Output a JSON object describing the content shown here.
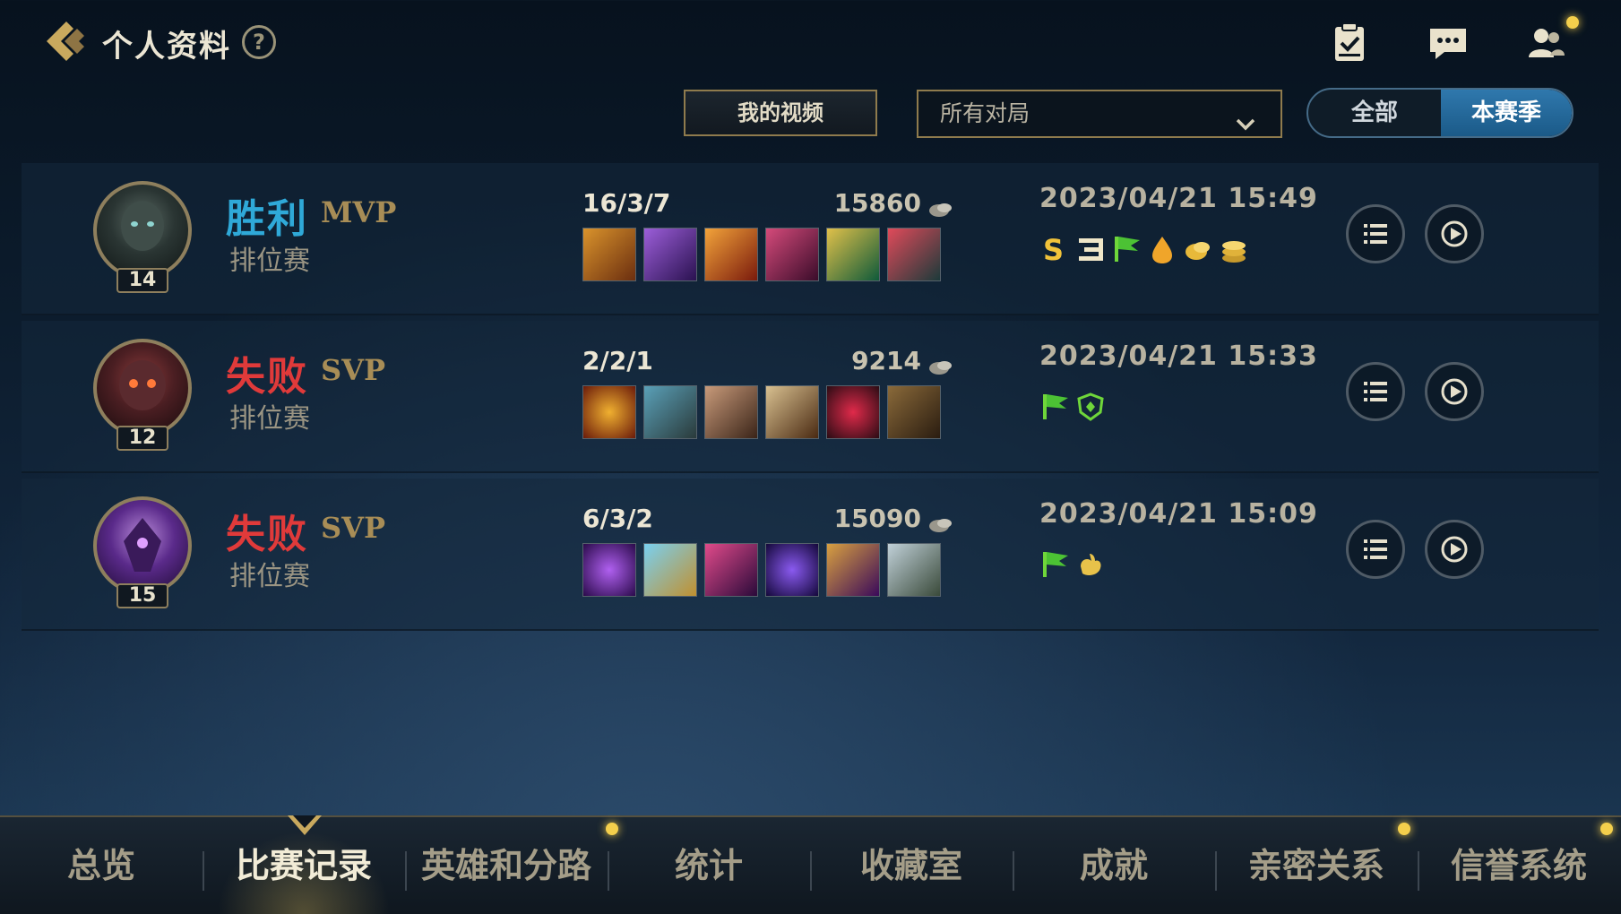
{
  "header": {
    "title": "个人资料",
    "help_label": "?",
    "icons": [
      "back-icon",
      "help-icon",
      "clipboard-check-icon",
      "chat-icon",
      "friends-icon"
    ]
  },
  "filters": {
    "my_videos_label": "我的视频",
    "game_filter_value": "所有对局",
    "scope_tabs": [
      {
        "label": "全部",
        "selected": false
      },
      {
        "label": "本赛季",
        "selected": true
      }
    ]
  },
  "matches": [
    {
      "result": "胜利",
      "result_type": "win",
      "award": "MVP",
      "mode": "排位赛",
      "level": "14",
      "kda": "16/3/7",
      "gold": "15860",
      "datetime": "2023/04/21 15:49",
      "items": [
        "item-icon",
        "item-icon",
        "item-icon",
        "item-icon",
        "item-icon",
        "boots-icon"
      ],
      "badges": [
        "s-badge-icon",
        "triple-kill-icon",
        "flag-icon",
        "flame-drop-icon",
        "coin-icon",
        "coin-stack-icon"
      ]
    },
    {
      "result": "失败",
      "result_type": "loss",
      "award": "SVP",
      "mode": "排位赛",
      "level": "12",
      "kda": "2/2/1",
      "gold": "9214",
      "datetime": "2023/04/21 15:33",
      "items": [
        "item-icon",
        "item-icon",
        "item-icon",
        "item-icon",
        "item-icon",
        "boots-icon"
      ],
      "badges": [
        "flag-icon",
        "shield-icon"
      ]
    },
    {
      "result": "失败",
      "result_type": "loss",
      "award": "SVP",
      "mode": "排位赛",
      "level": "15",
      "kda": "6/3/2",
      "gold": "15090",
      "datetime": "2023/04/21 15:09",
      "items": [
        "item-icon",
        "item-icon",
        "item-icon",
        "item-icon",
        "item-icon",
        "armor-icon"
      ],
      "badges": [
        "flag-icon",
        "hand-icon"
      ]
    }
  ],
  "bottom_nav": [
    {
      "label": "总览",
      "active": false,
      "dot": false
    },
    {
      "label": "比赛记录",
      "active": true,
      "dot": false
    },
    {
      "label": "英雄和分路",
      "active": false,
      "dot": true
    },
    {
      "label": "统计",
      "active": false,
      "dot": false
    },
    {
      "label": "收藏室",
      "active": false,
      "dot": false
    },
    {
      "label": "成就",
      "active": false,
      "dot": false
    },
    {
      "label": "亲密关系",
      "active": false,
      "dot": true
    },
    {
      "label": "信誉系统",
      "active": false,
      "dot": true
    }
  ],
  "colors": {
    "win": "#2fa9d8",
    "loss": "#e03a3a",
    "gold_accent": "#a88d56",
    "notify_dot": "#f4cf4c",
    "selected_tab": "#2f78ad"
  }
}
